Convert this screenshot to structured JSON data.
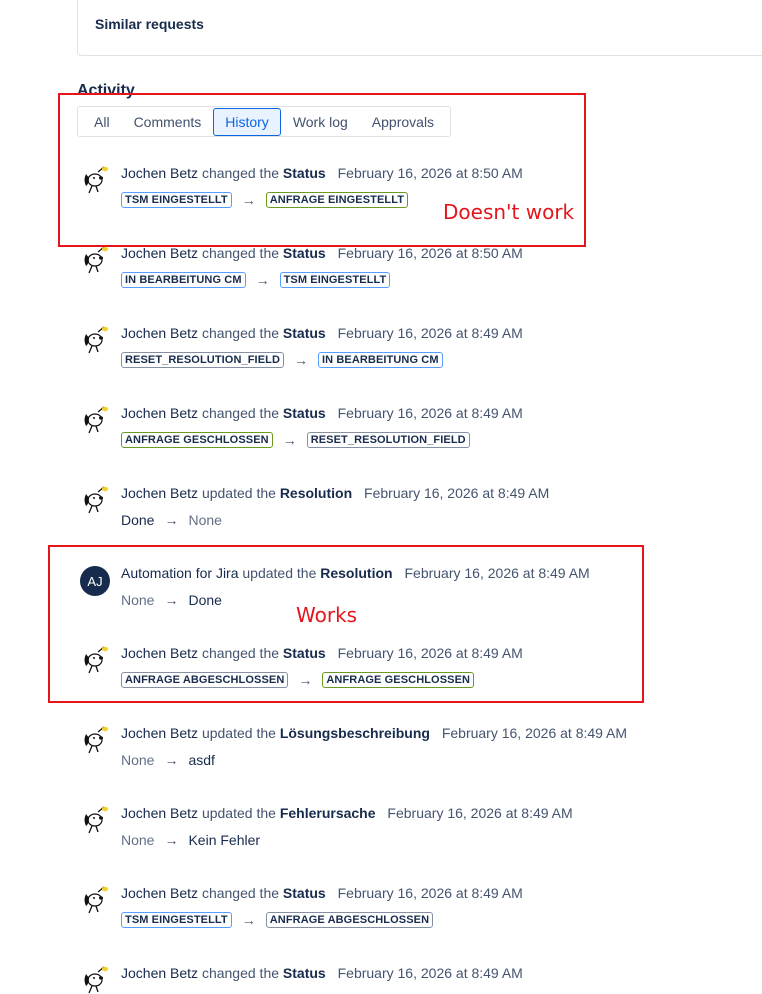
{
  "similar": {
    "title": "Similar requests"
  },
  "activity": {
    "title": "Activity",
    "tabs": [
      "All",
      "Comments",
      "History",
      "Work log",
      "Approvals"
    ],
    "selected_tab": "History"
  },
  "annotations": {
    "doesnt_work": "Doesn't work",
    "works": "Works"
  },
  "colors": {
    "annotation": "#e4161b",
    "tab_selected": "#0c66e4",
    "avatar_aj": "#172b4d"
  },
  "entries": [
    {
      "actor": "Jochen Betz",
      "verb": "changed the",
      "field": "Status",
      "date": "February 16, 2026 at 8:50 AM",
      "from": "TSM EINGESTELLT",
      "to": "ANFRAGE EINGESTELLT"
    },
    {
      "actor": "Jochen Betz",
      "verb": "changed the",
      "field": "Status",
      "date": "February 16, 2026 at 8:50 AM",
      "from": "IN BEARBEITUNG CM",
      "to": "TSM EINGESTELLT"
    },
    {
      "actor": "Jochen Betz",
      "verb": "changed the",
      "field": "Status",
      "date": "February 16, 2026 at 8:49 AM",
      "from": "RESET_RESOLUTION_FIELD",
      "to": "IN BEARBEITUNG CM"
    },
    {
      "actor": "Jochen Betz",
      "verb": "changed the",
      "field": "Status",
      "date": "February 16, 2026 at 8:49 AM",
      "from": "ANFRAGE GESCHLOSSEN",
      "to": "RESET_RESOLUTION_FIELD"
    },
    {
      "actor": "Jochen Betz",
      "verb": "updated the",
      "field": "Resolution",
      "date": "February 16, 2026 at 8:49 AM",
      "from": "Done",
      "to": "None"
    },
    {
      "actor": "Automation for Jira",
      "avatar": "AJ",
      "verb": "updated the",
      "field": "Resolution",
      "date": "February 16, 2026 at 8:49 AM",
      "from": "None",
      "to": "Done"
    },
    {
      "actor": "Jochen Betz",
      "verb": "changed the",
      "field": "Status",
      "date": "February 16, 2026 at 8:49 AM",
      "from": "ANFRAGE ABGESCHLOSSEN",
      "to": "ANFRAGE GESCHLOSSEN"
    },
    {
      "actor": "Jochen Betz",
      "verb": "updated the",
      "field": "Lösungsbeschreibung",
      "date": "February 16, 2026 at 8:49 AM",
      "from": "None",
      "to": "asdf"
    },
    {
      "actor": "Jochen Betz",
      "verb": "updated the",
      "field": "Fehlerursache",
      "date": "February 16, 2026 at 8:49 AM",
      "from": "None",
      "to": "Kein Fehler"
    },
    {
      "actor": "Jochen Betz",
      "verb": "changed the",
      "field": "Status",
      "date": "February 16, 2026 at 8:49 AM",
      "from": "TSM EINGESTELLT",
      "to": "ANFRAGE ABGESCHLOSSEN"
    },
    {
      "actor": "Jochen Betz",
      "verb": "changed the",
      "field": "Status",
      "date": "February 16, 2026 at 8:49 AM"
    }
  ]
}
